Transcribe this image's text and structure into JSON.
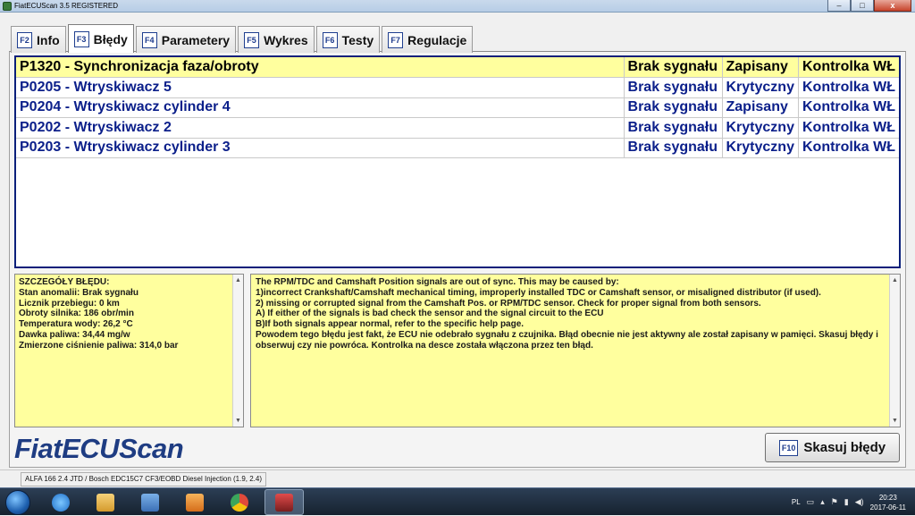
{
  "window": {
    "title": "FiatECUScan 3.5 REGISTERED",
    "buttons": {
      "minimize": "–",
      "maximize": "□",
      "close": "x"
    }
  },
  "tabs": [
    {
      "key": "F2",
      "label": "Info"
    },
    {
      "key": "F3",
      "label": "Błędy"
    },
    {
      "key": "F4",
      "label": "Parametery"
    },
    {
      "key": "F5",
      "label": "Wykres"
    },
    {
      "key": "F6",
      "label": "Testy"
    },
    {
      "key": "F7",
      "label": "Regulacje"
    }
  ],
  "active_tab": "F3",
  "faults": [
    {
      "code": "P1320 - Synchronizacja faza/obroty",
      "signal": "Brak sygnału",
      "state": "Zapisany",
      "lamp": "Kontrolka WŁ"
    },
    {
      "code": "P0205 - Wtryskiwacz 5",
      "signal": "Brak sygnału",
      "state": "Krytyczny",
      "lamp": "Kontrolka WŁ"
    },
    {
      "code": "P0204 - Wtryskiwacz cylinder 4",
      "signal": "Brak sygnału",
      "state": "Zapisany",
      "lamp": "Kontrolka WŁ"
    },
    {
      "code": "P0202 - Wtryskiwacz 2",
      "signal": "Brak sygnału",
      "state": "Krytyczny",
      "lamp": "Kontrolka WŁ"
    },
    {
      "code": "P0203 - Wtryskiwacz cylinder 3",
      "signal": "Brak sygnału",
      "state": "Krytyczny",
      "lamp": "Kontrolka WŁ"
    }
  ],
  "details": {
    "lines": [
      "SZCZEGÓŁY BŁĘDU:",
      "Stan anomalii: Brak sygnału",
      "Licznik przebiegu: 0 km",
      "Obroty silnika: 186 obr/min",
      "Temperatura wody: 26,2 °C",
      "Dawka paliwa: 34,44 mg/w",
      "Zmierzone ciśnienie paliwa: 314,0 bar"
    ]
  },
  "help": {
    "lines": [
      "The RPM/TDC and Camshaft Position signals are out of sync. This may be caused by:",
      "1)incorrect Crankshaft/Camshaft mechanical timing, improperly installed TDC or Camshaft sensor, or misaligned distributor (if used).",
      "2) missing or corrupted signal from the Camshaft Pos. or RPM/TDC sensor. Check for proper signal from both sensors.",
      "A) If either of the signals is bad check the sensor and the signal circuit to the ECU",
      "B)If both signals appear normal, refer to the specific help page.",
      "Powodem tego błędu jest fakt, że ECU nie odebrało sygnału z czujnika. Błąd obecnie nie jest aktywny ale został zapisany w pamięci. Skasuj błędy i obserwuj czy nie powróca. Kontrolka na desce została włączona przez ten błąd."
    ]
  },
  "logo": "FiatECUScan",
  "clear_button": {
    "key": "F10",
    "label": "Skasuj błędy"
  },
  "status": {
    "vehicle": "ALFA 166 2.4 JTD / Bosch EDC15C7 CF3/EOBD Diesel Injection (1.9, 2.4)"
  },
  "taskbar": {
    "apps": [
      "start-orb",
      "ie",
      "explorer",
      "media",
      "player",
      "chrome",
      "fiatecuscan"
    ],
    "lang": "PL",
    "time": "20:23",
    "date": "2017-06-11"
  },
  "colors": {
    "selected_row": "#ffff9e",
    "fault_text": "#0b1f8a",
    "logo": "#1e3c82",
    "panel_bg": "#ffff9e"
  }
}
